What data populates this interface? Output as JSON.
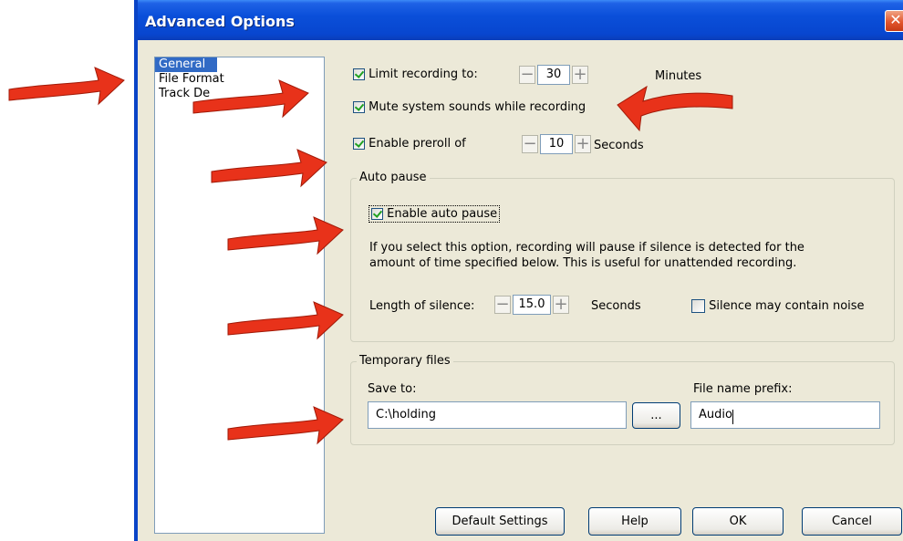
{
  "window": {
    "title": "Advanced Options",
    "close_glyph": "✕"
  },
  "nav": {
    "items": [
      {
        "label": "General",
        "selected": true
      },
      {
        "label": "File Format",
        "selected": false
      },
      {
        "label": "Track De",
        "selected": false
      }
    ]
  },
  "general": {
    "limit_recording": {
      "label": "Limit recording to:",
      "checked": true,
      "value": "30",
      "unit": "Minutes"
    },
    "mute_system_sounds": {
      "label": "Mute system sounds while recording",
      "checked": true
    },
    "preroll": {
      "label": "Enable preroll of",
      "checked": true,
      "value": "10",
      "unit": "Seconds"
    },
    "auto_pause": {
      "group_title": "Auto pause",
      "enable_label": "Enable auto pause",
      "enable_checked": true,
      "description_line1": "If you select this option, recording will pause if silence is detected for the",
      "description_line2": "amount of time specified below. This is useful for unattended recording.",
      "silence_label": "Length of silence:",
      "silence_value": "15.0",
      "silence_unit": "Seconds",
      "noise_label": "Silence may contain noise",
      "noise_checked": false
    },
    "temp_files": {
      "group_title": "Temporary files",
      "save_to_label": "Save to:",
      "save_to_value": "C:\\holding",
      "browse_label": "...",
      "prefix_label": "File name prefix:",
      "prefix_value": "Audio"
    }
  },
  "footer": {
    "default_label": "Default Settings",
    "help_label": "Help",
    "ok_label": "OK",
    "cancel_label": "Cancel"
  },
  "spin": {
    "minus": "−",
    "plus": "+"
  },
  "colors": {
    "arrow": "#e8321a",
    "selection": "#316ac5",
    "titlebar": "#0a4fd9"
  }
}
